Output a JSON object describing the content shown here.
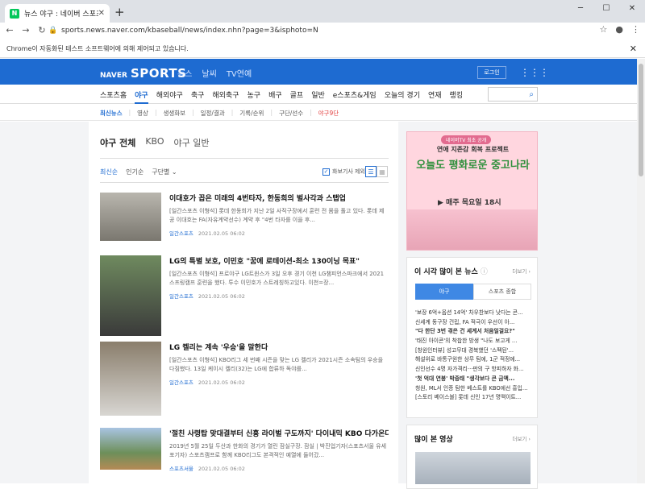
{
  "browser": {
    "tab_title": "뉴스 야구 : 네이버 스포츠",
    "tab_favicon": "N",
    "url": "sports.news.naver.com/kbaseball/news/index.nhn?page=3&isphoto=N",
    "infobar": "Chrome이 자동화된 테스트 소프트웨어에 의해 제어되고 있습니다."
  },
  "gnb": {
    "logo_naver": "NAVER",
    "logo_sports": "SPORTS",
    "links": [
      "뉴스",
      "날씨",
      "TV연예"
    ],
    "login": "로그인"
  },
  "menu1": [
    "스포츠홈",
    "야구",
    "해외야구",
    "축구",
    "해외축구",
    "농구",
    "배구",
    "골프",
    "일반",
    "e스포츠&게임",
    "오늘의 경기",
    "연재",
    "랭킹"
  ],
  "menu2": [
    "최신뉴스",
    "영상",
    "생생화보",
    "일정/결과",
    "기록/순위",
    "구단/선수",
    "야구9단"
  ],
  "main": {
    "filters": [
      "야구 전체",
      "KBO",
      "야구 일반"
    ],
    "sorts": [
      "최신순",
      "인기순",
      "구단별"
    ],
    "photo_only": "화보기사 제외",
    "articles": [
      {
        "title": "이대호가 꼽은 미래의 4번타자, 한동희의 벌사각과 스탭업",
        "summary": "[일간스포츠 이형석] 롯데 한동희가 지난 2일 사직구장에서 훈련 전 몸을 풀고 있다. 롯데 제공 이대호는 FA(자유계약선수) 계약 후 \"4번 타자를 이을 후...",
        "source": "일간스포츠",
        "time": "2021.02.05 06:02"
      },
      {
        "title": "LG의 특별 보호, 이민호 \"꿈에 로테이션-최소 130이닝 목표\"",
        "summary": "[일간스포츠 이형석] 프로야구 LG트윈스가 3일 오후 경기 이천 LG챔피언스파크에서 2021스프링캠프 훈련을 했다. 투수 이민호가 스트레칭하고있다. 이천=장...",
        "source": "일간스포츠",
        "time": "2021.02.05 06:02"
      },
      {
        "title": "LG 켈리는 계속 '우승'을 말한다",
        "summary": "[일간스포츠 이형석] KBO리그 세 번째 시즌을 맞는 LG 켈리가 2021시즌 소속팀의 우승을 다짐했다. 13일 케이시 켈리(32)는 LG에 합류하 독야를...",
        "source": "일간스포츠",
        "time": "2021.02.05 06:02"
      },
      {
        "title": "'절친 사령탑 맞대결부터 신흥 라이벌 구도까지' 다이내믹 KBO 다가온다",
        "summary": "2019년 5월 25일 두산과 한화의 경기가 열린 잠실구장. 잠실 | 박진업기자(스포츠서울 유세포기자) 스포츠캠프로 함께 KBO리그도 본격적인 예열에 들어갔...",
        "source": "스포츠서울",
        "time": "2021.02.05 06:02"
      }
    ]
  },
  "aside": {
    "ad": {
      "badge": "네이버TV 최초 공개",
      "line1": "연애 지존감 회복 프로젝트",
      "line2": "오늘도 평화로운 중고나라",
      "line3": "▶ 매주 목요일 18시"
    },
    "popular": {
      "title": "이 시각 많이 본 뉴스",
      "more": "더보기",
      "tabs": [
        "야구",
        "스포츠 종합"
      ],
      "items": [
        "'보장 6억+옵션 14억' 차우찬보다 낫다는 콘...",
        "신세계 동구장 건립, FA 적극이 우선이 아...",
        "\"다 한단 3번 겪은 건 세계서 처음일걸요?\"",
        "'태진 아이콘'의 착찹한 방생 \"나도 보고게 ...",
        "[창원인터뷰] 성고무대 경북했던 '스펙된'...",
        "해설위로 바통구원한 상무 팀에, 1군 적정에...",
        "신인선수 4명 자가격리···판의 구 항피하자 화...",
        "'첫 억대 연봉' 박중태 \"생각보다 큰 금액...",
        "청원, ML서 인종 탐한 베스트를 KBO에선 흥입...",
        "[스토리 베이스볼] 롯데 신인 17년 명맥이트..."
      ]
    },
    "video": {
      "title": "많이 본 영상",
      "more": "더보기"
    }
  }
}
